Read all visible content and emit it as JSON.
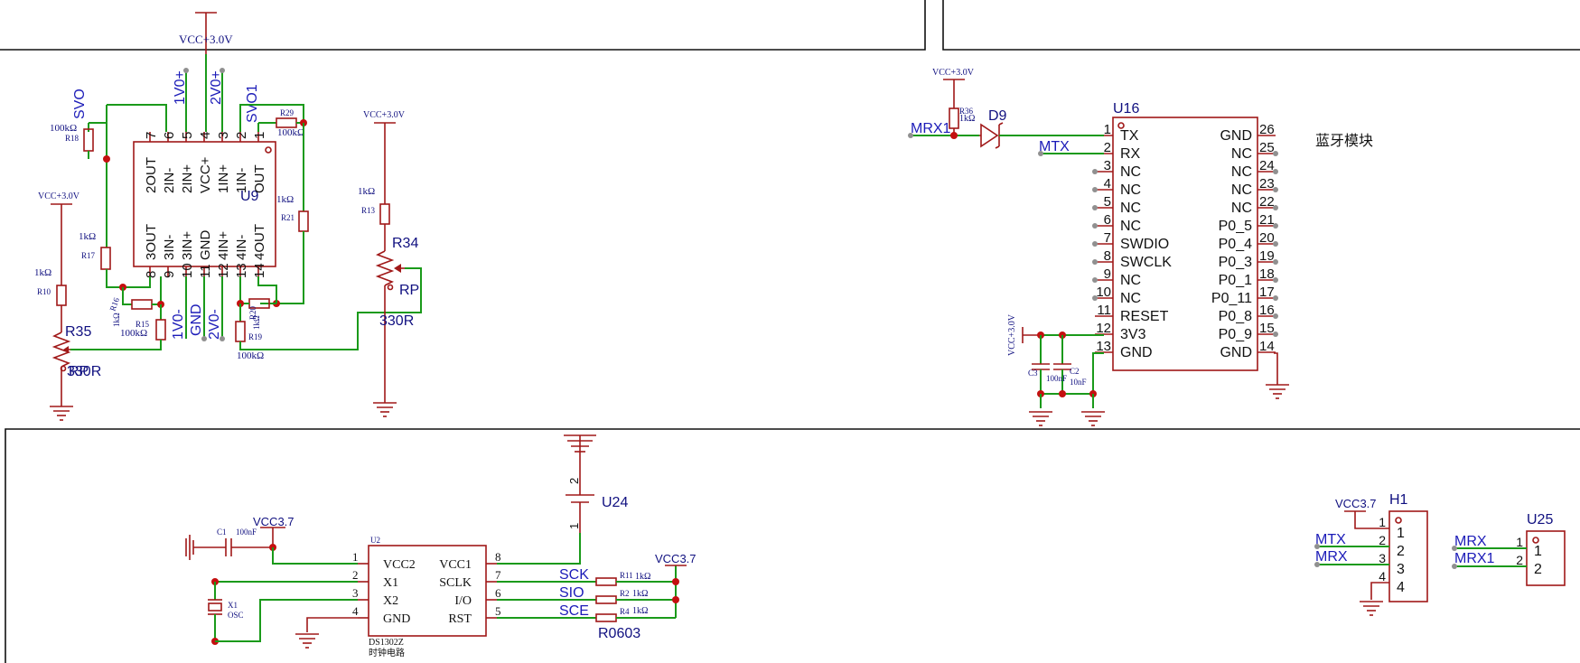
{
  "power": {
    "vcc30": "VCC+3.0V",
    "vcc37": "VCC3.7"
  },
  "u9": {
    "ref": "U9",
    "top_pins": [
      {
        "num": "7",
        "name": "2OUT"
      },
      {
        "num": "6",
        "name": "2IN-"
      },
      {
        "num": "5",
        "name": "2IN+"
      },
      {
        "num": "4",
        "name": "VCC+"
      },
      {
        "num": "3",
        "name": "1IN+"
      },
      {
        "num": "2",
        "name": "1IN-"
      },
      {
        "num": "1",
        "name": "OUT"
      }
    ],
    "bottom_pins": [
      {
        "num": "8",
        "name": "3OUT"
      },
      {
        "num": "9",
        "name": "3IN-"
      },
      {
        "num": "10",
        "name": "3IN+"
      },
      {
        "num": "11",
        "name": "GND"
      },
      {
        "num": "12",
        "name": "4IN+"
      },
      {
        "num": "13",
        "name": "4IN-"
      },
      {
        "num": "14",
        "name": "4OUT"
      }
    ],
    "nets_top": [
      "SVO",
      "1V0+",
      "2V0+",
      "SVO1"
    ],
    "nets_bottom": [
      "1V0-",
      "GND",
      "2V0-"
    ]
  },
  "resistors": {
    "r18": {
      "ref": "R18",
      "value": "100kΩ"
    },
    "r29": {
      "ref": "R29",
      "value": "100kΩ"
    },
    "r17": {
      "ref": "R17",
      "value": "1kΩ"
    },
    "r21": {
      "ref": "R21",
      "value": "1kΩ"
    },
    "r10": {
      "ref": "R10",
      "value": "1kΩ"
    },
    "r16": {
      "ref": "R16",
      "value": "1kΩ"
    },
    "r15": {
      "ref": "R15",
      "value": "100kΩ"
    },
    "r20": {
      "ref": "R20",
      "value": "1kΩ"
    },
    "r19": {
      "ref": "R19",
      "value": "100kΩ"
    },
    "r13": {
      "ref": "R13",
      "value": "1kΩ"
    },
    "r36": {
      "ref": "R36",
      "value": "1kΩ"
    }
  },
  "pots": {
    "r35": {
      "ref": "R35",
      "value": "330R",
      "extra": "RP"
    },
    "r34": {
      "ref": "R34",
      "value": "330R",
      "extra": "RP"
    }
  },
  "u16": {
    "ref": "U16",
    "title": "蓝牙模块",
    "diode": "D9",
    "left_pins": [
      {
        "num": "1",
        "name": "TX"
      },
      {
        "num": "2",
        "name": "RX"
      },
      {
        "num": "3",
        "name": "NC"
      },
      {
        "num": "4",
        "name": "NC"
      },
      {
        "num": "5",
        "name": "NC"
      },
      {
        "num": "6",
        "name": "NC"
      },
      {
        "num": "7",
        "name": "SWDIO"
      },
      {
        "num": "8",
        "name": "SWCLK"
      },
      {
        "num": "9",
        "name": "NC"
      },
      {
        "num": "10",
        "name": "NC"
      },
      {
        "num": "11",
        "name": "RESET"
      },
      {
        "num": "12",
        "name": "3V3"
      },
      {
        "num": "13",
        "name": "GND"
      }
    ],
    "right_pins": [
      {
        "num": "26",
        "name": "GND"
      },
      {
        "num": "25",
        "name": "NC"
      },
      {
        "num": "24",
        "name": "NC"
      },
      {
        "num": "23",
        "name": "NC"
      },
      {
        "num": "22",
        "name": "NC"
      },
      {
        "num": "21",
        "name": "P0_5"
      },
      {
        "num": "20",
        "name": "P0_4"
      },
      {
        "num": "19",
        "name": "P0_3"
      },
      {
        "num": "18",
        "name": "P0_1"
      },
      {
        "num": "17",
        "name": "P0_11"
      },
      {
        "num": "16",
        "name": "P0_8"
      },
      {
        "num": "15",
        "name": "P0_9"
      },
      {
        "num": "14",
        "name": "GND"
      }
    ],
    "net_mrx1": "MRX1",
    "net_mtx": "MTX",
    "c3": {
      "ref": "C3",
      "value": "100nF"
    },
    "c2": {
      "ref": "C2",
      "value": "10nF"
    }
  },
  "u2": {
    "ref": "U2",
    "part": "DS1302Z",
    "caption": "时钟电路",
    "left_pins": [
      {
        "num": "1",
        "name": "VCC2"
      },
      {
        "num": "2",
        "name": "X1"
      },
      {
        "num": "3",
        "name": "X2"
      },
      {
        "num": "4",
        "name": "GND"
      }
    ],
    "right_pins": [
      {
        "num": "8",
        "name": "VCC1"
      },
      {
        "num": "7",
        "name": "SCLK"
      },
      {
        "num": "6",
        "name": "I/O"
      },
      {
        "num": "5",
        "name": "RST"
      }
    ],
    "c1": {
      "ref": "C1",
      "value": "100nF"
    },
    "x1": {
      "ref": "X1",
      "value": "OSC"
    },
    "nets": [
      "SCK",
      "SIO",
      "SCE"
    ],
    "r11": {
      "ref": "R11",
      "value": "1kΩ"
    },
    "r2": {
      "ref": "R2",
      "value": "1kΩ"
    },
    "r4": {
      "ref": "R4",
      "value": "1kΩ"
    },
    "pkg": "R0603"
  },
  "u24": {
    "ref": "U24",
    "pin_top": "2",
    "pin_bot": "1"
  },
  "h1": {
    "ref": "H1",
    "pins": [
      "1",
      "2",
      "3",
      "4"
    ],
    "nets": [
      "MTX",
      "MRX"
    ]
  },
  "u25": {
    "ref": "U25",
    "pins": [
      "1",
      "2"
    ],
    "nets": [
      "MRX",
      "MRX1"
    ]
  }
}
